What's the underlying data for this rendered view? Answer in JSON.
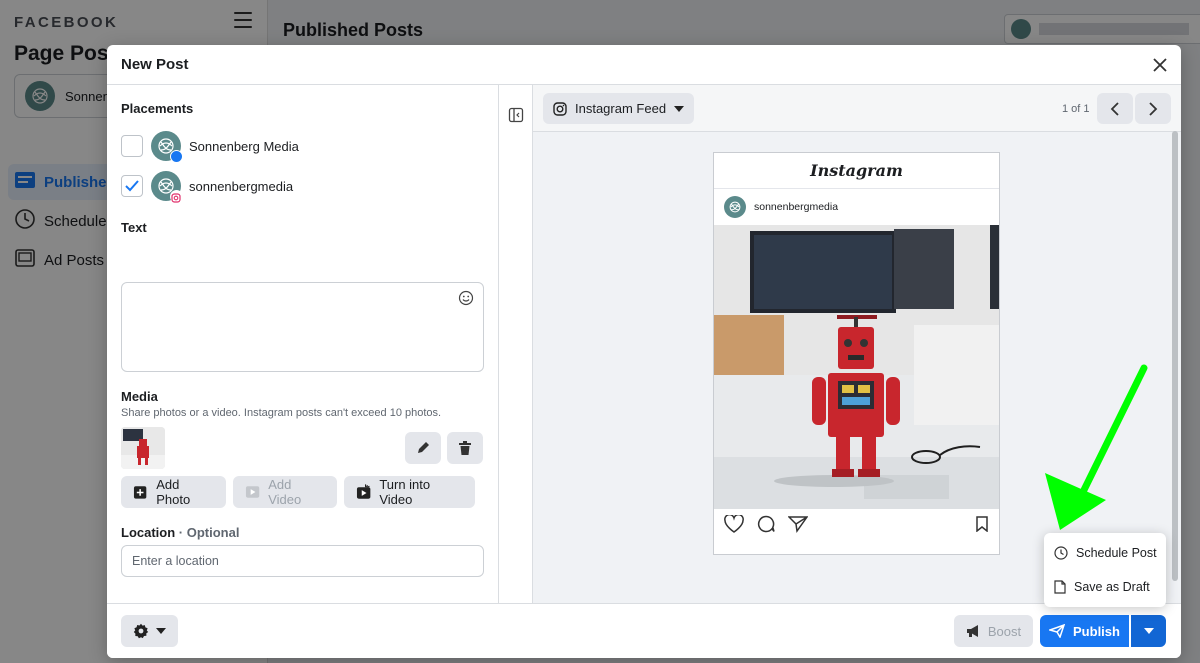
{
  "background": {
    "brand": "FACEBOOK",
    "page_title": "Page Posts",
    "account_name": "Sonnenberg Media",
    "nav": [
      {
        "label": "Published Posts"
      },
      {
        "label": "Scheduled Posts"
      },
      {
        "label": "Ad Posts"
      }
    ],
    "main_title": "Published Posts"
  },
  "modal": {
    "title": "New Post",
    "placements_label": "Placements",
    "placements": [
      {
        "name": "Sonnenberg Media",
        "checked": false,
        "network": "facebook"
      },
      {
        "name": "sonnenbergmedia",
        "checked": true,
        "network": "instagram"
      }
    ],
    "text_label": "Text",
    "text_value": "",
    "media_label": "Media",
    "media_help": "Share photos or a video. Instagram posts can't exceed 10 photos.",
    "buttons": {
      "add_photo": "Add Photo",
      "add_video": "Add Video",
      "turn_into_video": "Turn into Video"
    },
    "location_label": "Location",
    "location_optional": " · Optional",
    "location_placeholder": "Enter a location"
  },
  "preview": {
    "feed_select": "Instagram Feed",
    "page_count": "1 of 1",
    "ig_logo": "Instagram",
    "ig_username": "sonnenbergmedia"
  },
  "footer": {
    "boost": "Boost",
    "publish": "Publish"
  },
  "menu": {
    "items": [
      {
        "label": "Schedule Post",
        "icon": "clock-icon"
      },
      {
        "label": "Save as Draft",
        "icon": "document-icon"
      }
    ]
  },
  "colors": {
    "accent": "#1877f2",
    "annotation_arrow": "#00ff00"
  }
}
